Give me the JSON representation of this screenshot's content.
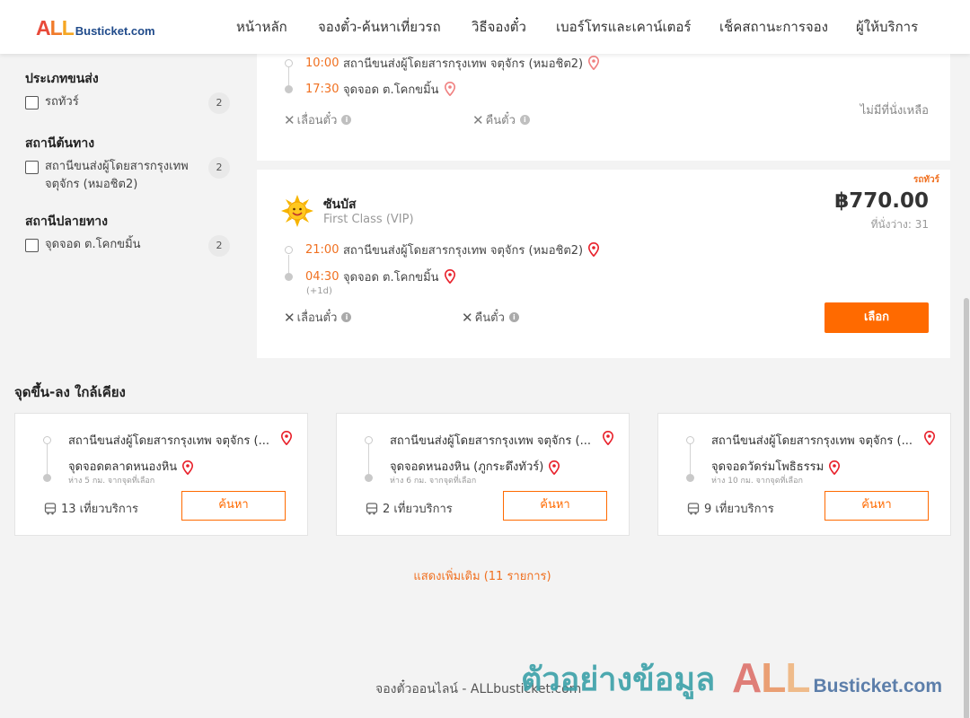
{
  "header": {
    "logo_all": "ALL",
    "logo_rest": "Busticket.com",
    "nav": [
      "หน้าหลัก",
      "จองตั๋ว-ค้นหาเที่ยวรถ",
      "วิธีจองตั๋ว",
      "เบอร์โทรและเคาน์เตอร์",
      "เช็คสถานะการจอง",
      "ผู้ให้บริการ"
    ]
  },
  "filters": {
    "transport_type": {
      "title": "ประเภทขนส่ง",
      "option": "รถทัวร์",
      "count": "2"
    },
    "origin": {
      "title": "สถานีต้นทาง",
      "option": "สถานีขนส่งผู้โดยสารกรุงเทพ จตุจักร (หมอชิต2)",
      "count": "2"
    },
    "destination": {
      "title": "สถานีปลายทาง",
      "option": "จุดจอด ต.โคกขมิ้น",
      "count": "2"
    }
  },
  "trips": [
    {
      "depart_time": "10:00",
      "depart_place": "สถานีขนส่งผู้โดยสารกรุงเทพ จตุจักร (หมอชิต2)",
      "arrive_time": "17:30",
      "arrive_place": "จุดจอด ต.โคกขมิ้น",
      "change_label": "เลื่อนตั๋ว",
      "refund_label": "คืนตั๋ว",
      "status": "ไม่มีที่นั่งเหลือ"
    },
    {
      "badge": "รถทัวร์",
      "operator": "ซันบัส",
      "class": "First Class (VIP)",
      "price": "฿770.00",
      "seats": "ที่นั่งว่าง: 31",
      "depart_time": "21:00",
      "depart_place": "สถานีขนส่งผู้โดยสารกรุงเทพ จตุจักร (หมอชิต2)",
      "arrive_time": "04:30",
      "arrive_place": "จุดจอด ต.โคกขมิ้น",
      "next_day": "(+1d)",
      "change_label": "เลื่อนตั๋ว",
      "refund_label": "คืนตั๋ว",
      "select_label": "เลือก"
    }
  ],
  "nearby": {
    "title": "จุดขึ้น-ลง ใกล้เคียง",
    "cards": [
      {
        "from": "สถานีขนส่งผู้โดยสารกรุงเทพ จตุจักร (...",
        "to": "จุดจอดตลาดหนองหิน",
        "distance": "ห่าง 5 กม. จากจุดที่เลือก",
        "services": "13 เที่ยวบริการ",
        "button": "ค้นหา"
      },
      {
        "from": "สถานีขนส่งผู้โดยสารกรุงเทพ จตุจักร (...",
        "to": "จุดจอดหนองหิน (ภูกระดึงทัวร์)",
        "distance": "ห่าง 6 กม. จากจุดที่เลือก",
        "services": "2 เที่ยวบริการ",
        "button": "ค้นหา"
      },
      {
        "from": "สถานีขนส่งผู้โดยสารกรุงเทพ จตุจักร (...",
        "to": "จุดจอดวัดร่มโพธิธรรม",
        "distance": "ห่าง 10 กม. จากจุดที่เลือก",
        "services": "9 เที่ยวบริการ",
        "button": "ค้นหา"
      }
    ]
  },
  "show_more": "แสดงเพิ่มเติม (11 รายการ)",
  "footer": "จองตั๋วออนไลน์ - ALLbusticket.com",
  "watermark": {
    "text": "ตัวอย่างข้อมูล",
    "logo_all": "ALL",
    "logo_rest": "Busticket.com"
  },
  "colors": {
    "accent": "#ff6a00",
    "time": "#f07020",
    "pin": "#e8202a",
    "watermark": "#3aa0a8"
  },
  "icons": [
    "map-pin-icon",
    "info-icon",
    "close-x-icon",
    "bus-icon",
    "sun-logo-icon"
  ]
}
